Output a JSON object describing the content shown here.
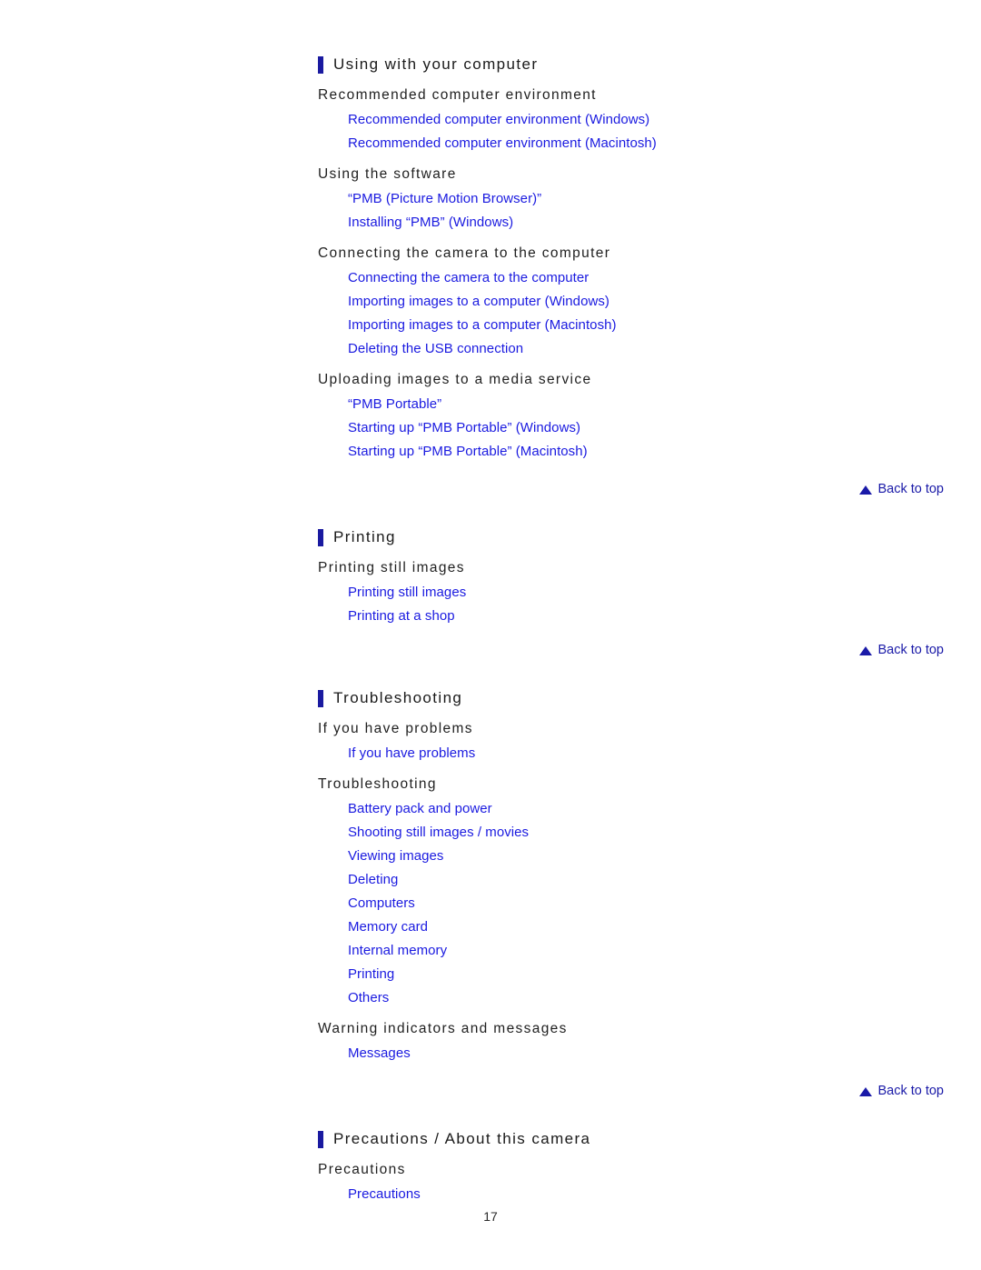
{
  "document": {
    "page_number": "17",
    "back_to_top_label": "Back to top",
    "back_to_top_icon": "triangle-up-icon",
    "link_color": "#1a1ae0",
    "accent_bar_color": "#1a1aa0",
    "heading_color": "#1a1a1a"
  },
  "sections": [
    {
      "title": "Using with your computer",
      "groups": [
        {
          "subtitle": "Recommended computer environment",
          "links": [
            "Recommended computer environment (Windows)",
            "Recommended computer environment (Macintosh)"
          ]
        },
        {
          "subtitle": "Using the software",
          "links": [
            "“PMB (Picture Motion Browser)”",
            "Installing “PMB” (Windows)"
          ]
        },
        {
          "subtitle": "Connecting the camera to the computer",
          "links": [
            "Connecting the camera to the computer",
            "Importing images to a computer (Windows)",
            "Importing images to a computer (Macintosh)",
            "Deleting the USB connection"
          ]
        },
        {
          "subtitle": "Uploading images to a media service",
          "links": [
            "“PMB Portable”",
            "Starting up “PMB Portable” (Windows)",
            "Starting up “PMB Portable” (Macintosh)"
          ]
        }
      ]
    },
    {
      "title": "Printing",
      "groups": [
        {
          "subtitle": "Printing still images",
          "links": [
            "Printing still images",
            "Printing at a shop"
          ]
        }
      ]
    },
    {
      "title": "Troubleshooting",
      "groups": [
        {
          "subtitle": "If you have problems",
          "links": [
            "If you have problems"
          ]
        },
        {
          "subtitle": "Troubleshooting",
          "links": [
            "Battery pack and power",
            "Shooting still images / movies",
            "Viewing images",
            "Deleting",
            "Computers",
            "Memory card",
            "Internal memory",
            "Printing",
            "Others"
          ]
        },
        {
          "subtitle": "Warning indicators and messages",
          "links": [
            "Messages"
          ]
        }
      ]
    },
    {
      "title": "Precautions / About this camera",
      "groups": [
        {
          "subtitle": "Precautions",
          "links": [
            "Precautions"
          ]
        }
      ]
    }
  ]
}
